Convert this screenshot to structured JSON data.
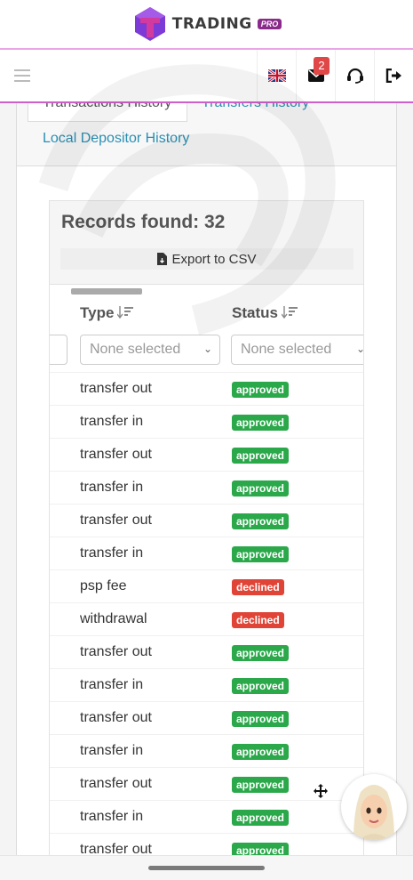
{
  "brand": {
    "name": "TRADING",
    "tag": "PRO"
  },
  "nav": {
    "unread_count": "2"
  },
  "tabs": {
    "transactions": "Transactions History",
    "transfers": "Transfers History",
    "local": "Local Depositor History"
  },
  "records": {
    "title": "Records found: 32",
    "export_label": "Export to CSV"
  },
  "columns": {
    "type": "Type",
    "status": "Status",
    "type_filter": "None selected",
    "status_filter": "None selected"
  },
  "colors": {
    "approved": "#2aa84a",
    "declined": "#e04436",
    "accent": "#cf5fcb"
  },
  "rows": [
    {
      "type": "transfer out",
      "status": "approved"
    },
    {
      "type": "transfer in",
      "status": "approved"
    },
    {
      "type": "transfer out",
      "status": "approved"
    },
    {
      "type": "transfer in",
      "status": "approved"
    },
    {
      "type": "transfer out",
      "status": "approved"
    },
    {
      "type": "transfer in",
      "status": "approved"
    },
    {
      "type": "psp fee",
      "status": "declined"
    },
    {
      "type": "withdrawal",
      "status": "declined"
    },
    {
      "type": "transfer out",
      "status": "approved"
    },
    {
      "type": "transfer in",
      "status": "approved"
    },
    {
      "type": "transfer out",
      "status": "approved"
    },
    {
      "type": "transfer in",
      "status": "approved"
    },
    {
      "type": "transfer out",
      "status": "approved"
    },
    {
      "type": "transfer in",
      "status": "approved"
    },
    {
      "type": "transfer out",
      "status": "approved"
    }
  ]
}
